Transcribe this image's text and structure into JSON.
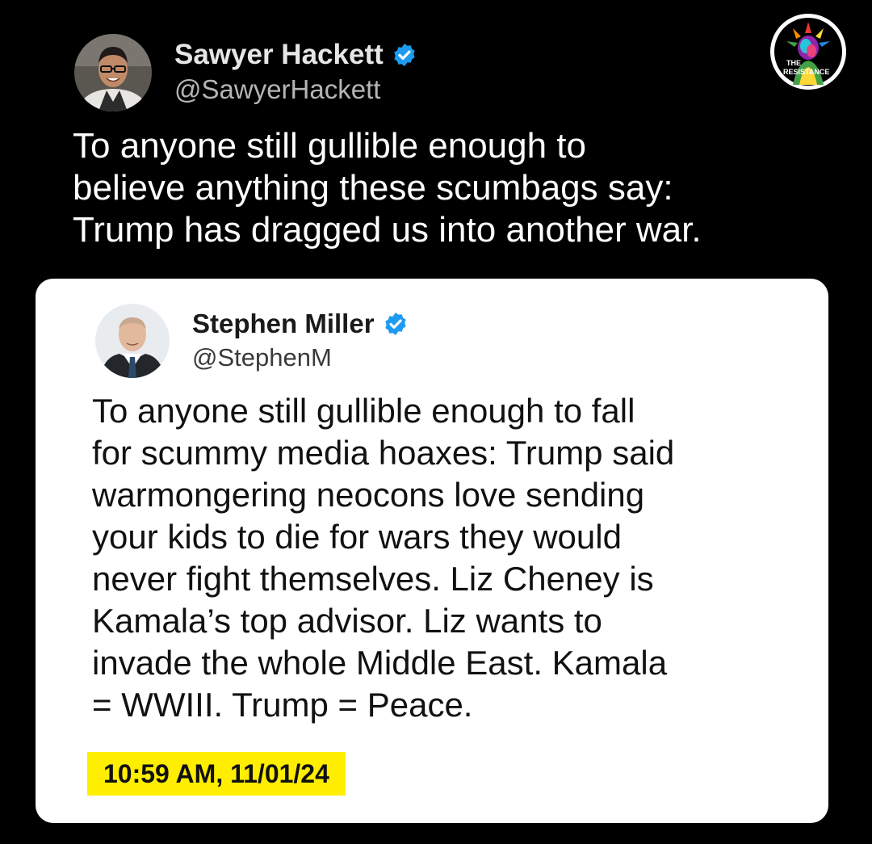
{
  "outer_tweet": {
    "display_name": "Sawyer Hackett",
    "handle": "@SawyerHackett",
    "verified_icon": "verified-badge-icon",
    "text_lines": [
      "To anyone still gullible enough to",
      "believe anything these scumbags say:",
      "Trump has dragged us into another war."
    ]
  },
  "badge": {
    "line1": "THE",
    "line2": "RESISTANCE",
    "icon": "statue-of-liberty-rainbow-logo"
  },
  "quoted_tweet": {
    "display_name": "Stephen Miller",
    "handle": "@StephenM",
    "verified_icon": "verified-badge-icon",
    "text_lines": [
      "To anyone still gullible enough to fall",
      "for scummy media hoaxes: Trump said",
      "warmongering neocons love sending",
      "your kids to die for wars they would",
      "never fight themselves. Liz Cheney is",
      "Kamala’s top advisor. Liz wants to",
      "invade the whole Middle East. Kamala",
      "= WWIII. Trump = Peace."
    ],
    "timestamp": "10:59 AM, 11/01/24"
  },
  "colors": {
    "background": "#000000",
    "card": "#ffffff",
    "verified": "#1d9bf0",
    "highlight": "#ffee00"
  }
}
